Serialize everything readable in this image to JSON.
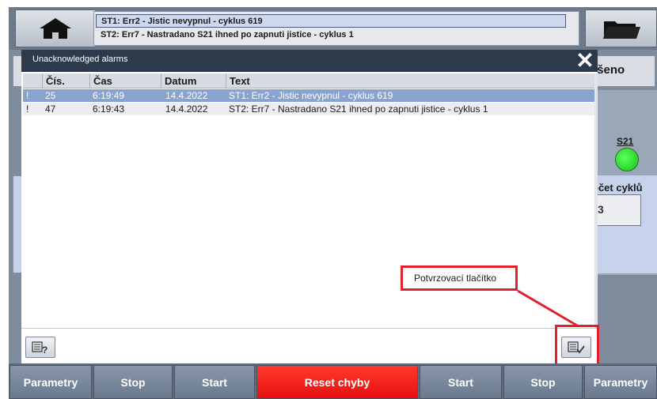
{
  "banner": {
    "line1": "ST1: Err2 - Jistic nevypnul - cyklus 619",
    "line2": "ST2: Err7 - Nastradano S21 ihned po zapnuti jistice - cyklus 1"
  },
  "background": {
    "status_text": "ušeno",
    "lamp_label": "S21",
    "cycle_label": "očet cyklů",
    "cycle_value": "3"
  },
  "alarm_window": {
    "title": "Unacknowledged alarms",
    "close_icon": "close-icon",
    "columns": [
      "Čís.",
      "Čas",
      "Datum",
      "Text"
    ],
    "rows": [
      {
        "flag": "!",
        "num": "25",
        "time": "6:19:49",
        "date": "14.4.2022",
        "text": "ST1: Err2 - Jistic nevypnul - cyklus 619"
      },
      {
        "flag": "!",
        "num": "47",
        "time": "6:19:43",
        "date": "14.4.2022",
        "text": "ST2: Err7 - Nastradano S21 ihned po zapnuti jistice - cyklus 1"
      }
    ]
  },
  "annotation": {
    "label": "Potvrzovací tlačítko",
    "color": "#e1202a"
  },
  "function_buttons": [
    {
      "label": "Parametry"
    },
    {
      "label": "Stop"
    },
    {
      "label": "Start"
    },
    {
      "label": "Reset chyby",
      "color": "#ff1a12"
    },
    {
      "label": "Start"
    },
    {
      "label": "Stop"
    },
    {
      "label": "Parametry"
    }
  ],
  "icons": {
    "home": "home-icon",
    "folder": "folder-icon",
    "info": "alarm-info-icon",
    "acknowledge": "acknowledge-icon"
  }
}
